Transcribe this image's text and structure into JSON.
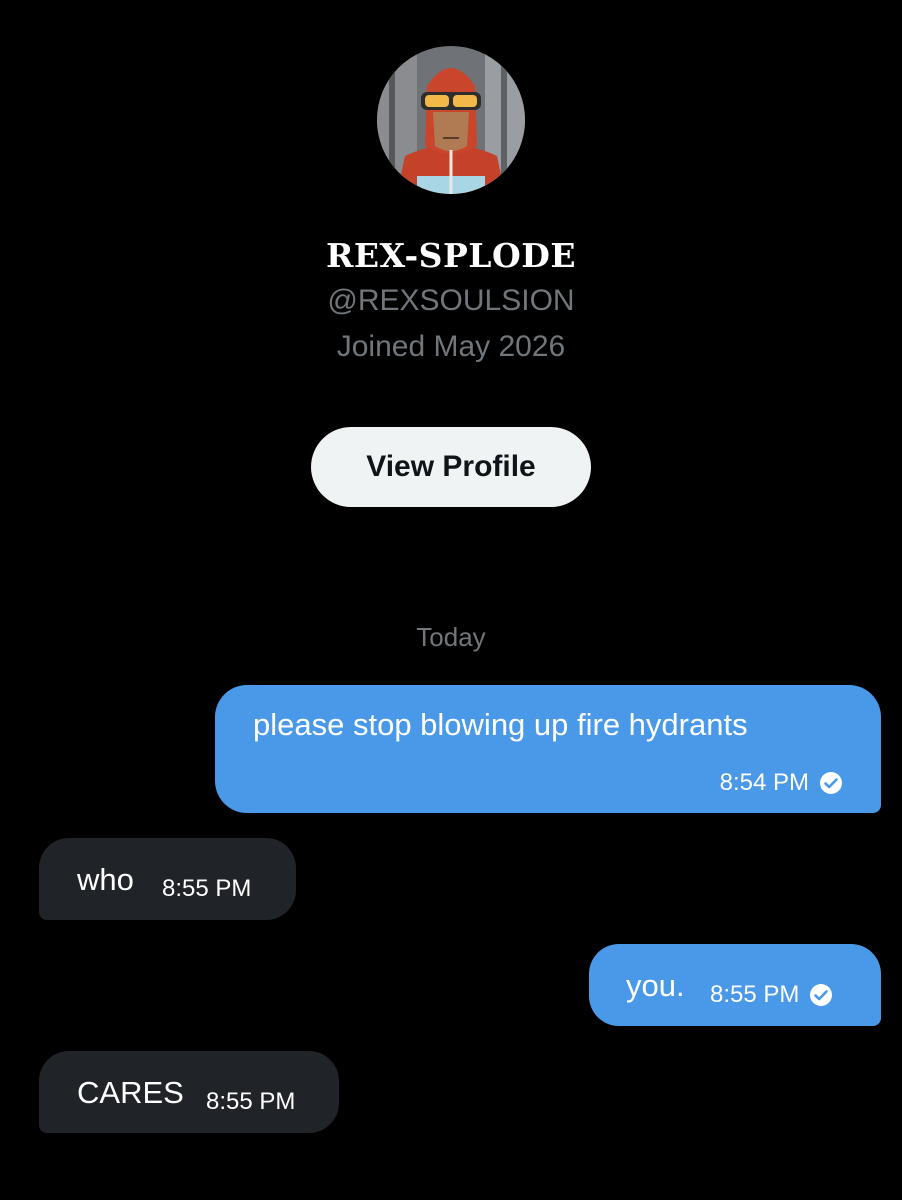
{
  "profile": {
    "display_name": "REX-SPLODE",
    "handle": "@REXSOULSION",
    "joined": "Joined May 2026",
    "view_profile_label": "View Profile"
  },
  "conversation": {
    "day_label": "Today",
    "messages": [
      {
        "direction": "sent",
        "text": "please stop blowing up fire hydrants",
        "time": "8:54 PM",
        "status_icon": "check-circle-icon"
      },
      {
        "direction": "received",
        "text": "who",
        "time": "8:55 PM"
      },
      {
        "direction": "sent",
        "text": "you.",
        "time": "8:55 PM",
        "status_icon": "check-circle-icon"
      },
      {
        "direction": "received",
        "text": "CARES",
        "time": "8:55 PM"
      }
    ]
  },
  "colors": {
    "background": "#000000",
    "sent_bubble": "#4a99e9",
    "received_bubble": "#202327",
    "secondary_text": "#71767b",
    "button_bg": "#eff3f4"
  }
}
